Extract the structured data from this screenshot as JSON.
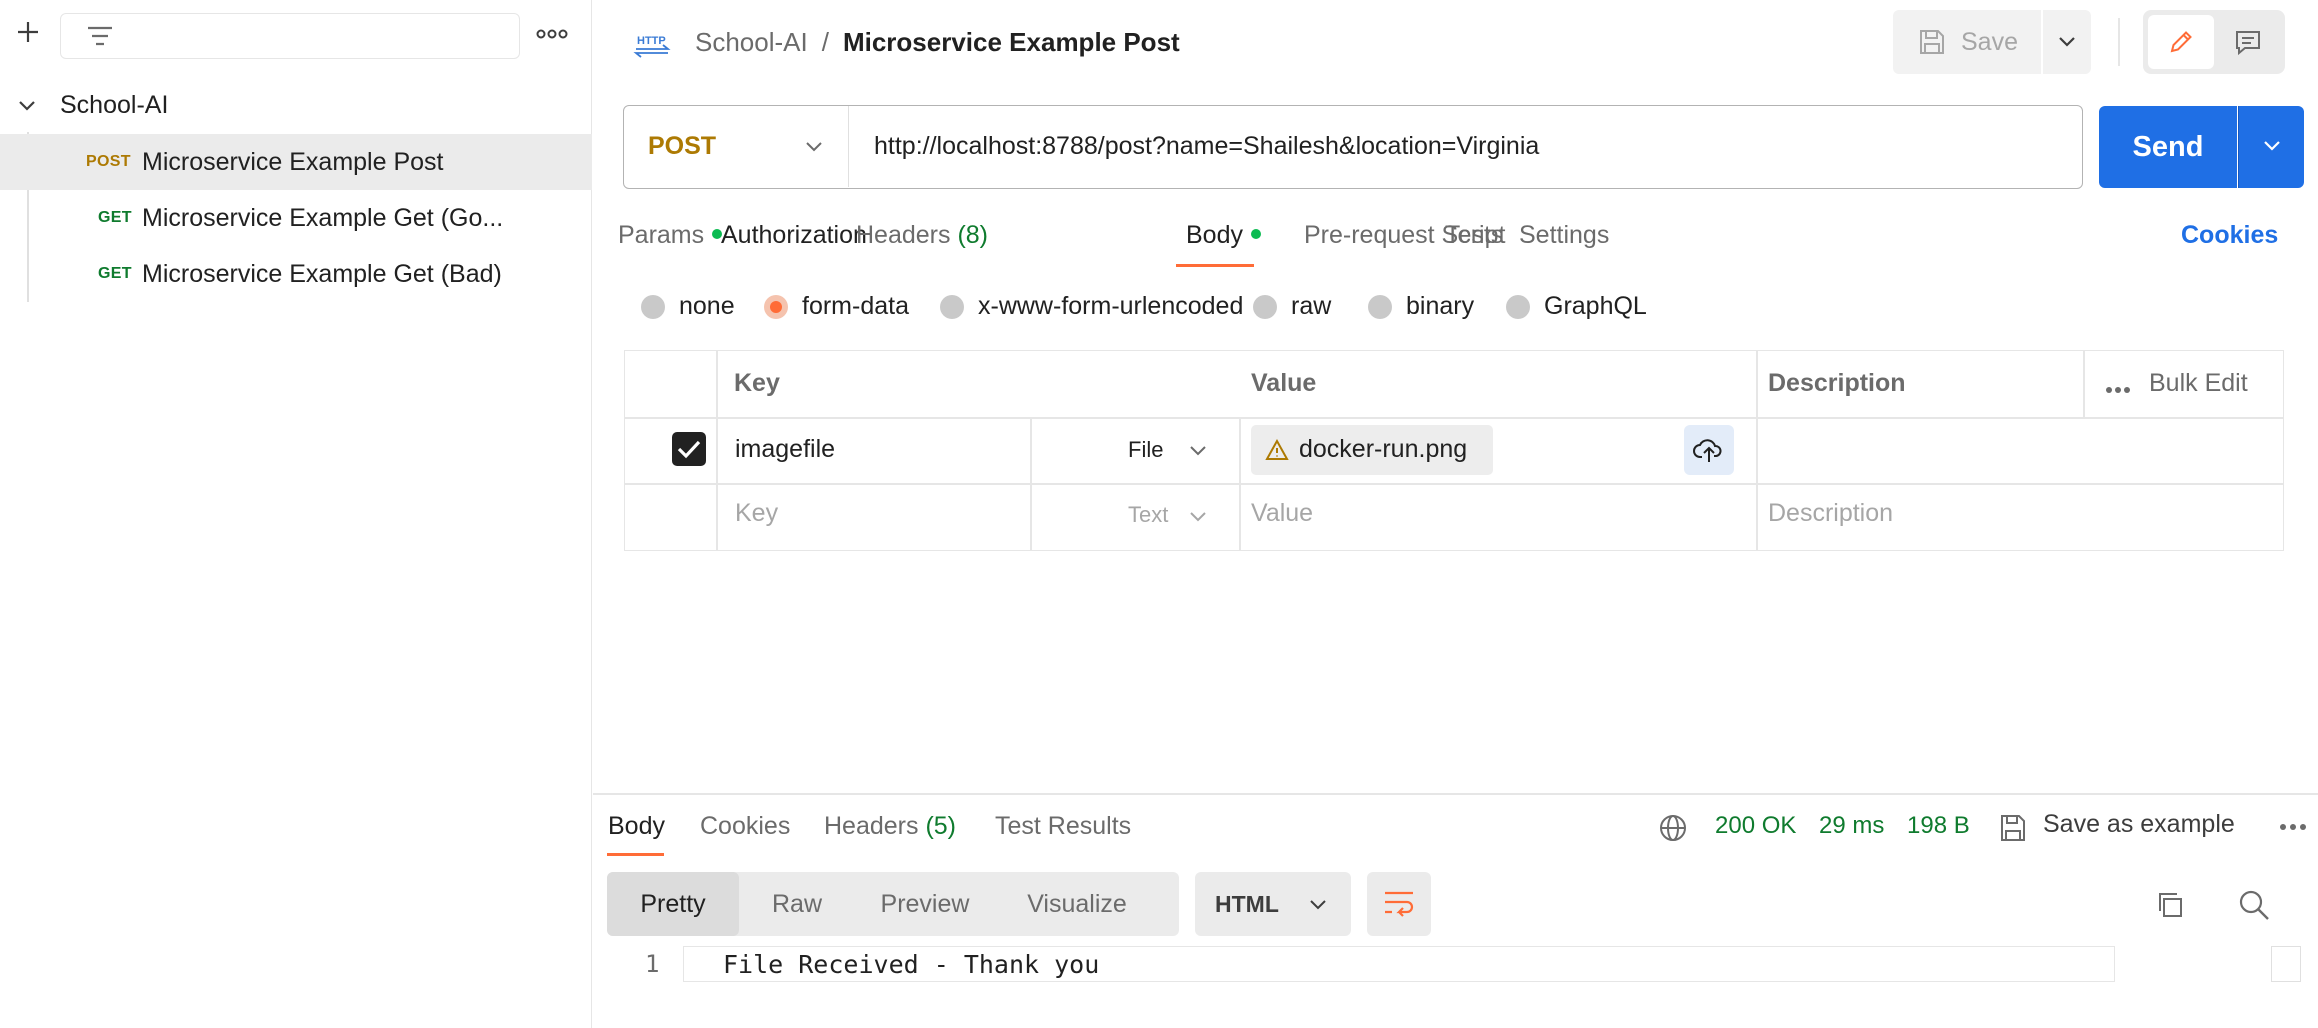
{
  "sidebar": {
    "folder": "School-AI",
    "items": [
      {
        "method": "POST",
        "name": "Microservice Example Post"
      },
      {
        "method": "GET",
        "name": "Microservice Example Get (Go..."
      },
      {
        "method": "GET",
        "name": "Microservice Example Get (Bad)"
      }
    ]
  },
  "header": {
    "workspace": "School-AI",
    "separator": "/",
    "title": "Microservice Example Post",
    "save_label": "Save"
  },
  "request": {
    "method": "POST",
    "url": "http://localhost:8788/post?name=Shailesh&location=Virginia",
    "send_label": "Send"
  },
  "tabs": {
    "params": "Params",
    "authorization": "Authorization",
    "headers": "Headers",
    "headers_count": "(8)",
    "body": "Body",
    "prerequest": "Pre-request Script",
    "tests": "Tests",
    "settings": "Settings",
    "cookies": "Cookies"
  },
  "body_modes": {
    "none": "none",
    "form_data": "form-data",
    "urlencoded": "x-www-form-urlencoded",
    "raw": "raw",
    "binary": "binary",
    "graphql": "GraphQL",
    "selected": "form-data"
  },
  "form_table": {
    "headers": {
      "key": "Key",
      "value": "Value",
      "description": "Description",
      "bulk_edit": "Bulk Edit"
    },
    "row": {
      "key": "imagefile",
      "type": "File",
      "value": "docker-run.png",
      "checked": true
    },
    "placeholder": {
      "key": "Key",
      "type": "Text",
      "value": "Value",
      "description": "Description"
    }
  },
  "response": {
    "tabs": {
      "body": "Body",
      "cookies": "Cookies",
      "headers": "Headers",
      "headers_count": "(5)",
      "tests": "Test Results"
    },
    "status": "200 OK",
    "time": "29 ms",
    "size": "198 B",
    "save_example": "Save as example",
    "views": {
      "pretty": "Pretty",
      "raw": "Raw",
      "preview": "Preview",
      "visualize": "Visualize"
    },
    "format": "HTML",
    "line_number": "1",
    "body_text": "File Received - Thank you"
  },
  "colors": {
    "accent": "#ff6c37",
    "send": "#1f6fe5",
    "post": "#ad7a03",
    "get": "#0f7b2e",
    "ok": "#0f7b2e"
  }
}
